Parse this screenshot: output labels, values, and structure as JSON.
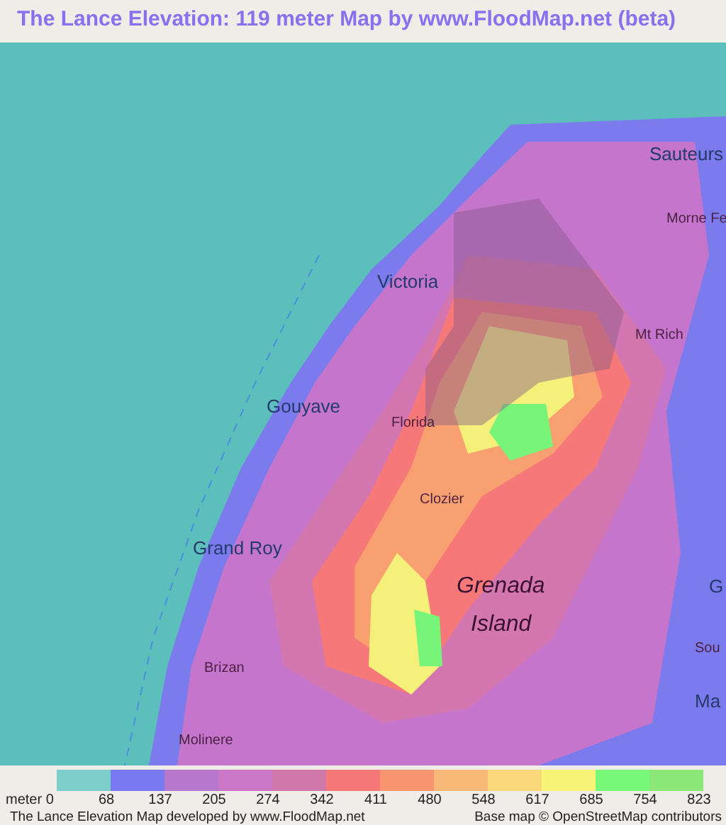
{
  "title": "The Lance Elevation: 119 meter Map by www.FloodMap.net (beta)",
  "map": {
    "places": [
      {
        "name": "Sauteurs",
        "kind": "town"
      },
      {
        "name": "Morne Fe",
        "kind": "small"
      },
      {
        "name": "Victoria",
        "kind": "town"
      },
      {
        "name": "Mt Rich",
        "kind": "small"
      },
      {
        "name": "Gouyave",
        "kind": "town"
      },
      {
        "name": "Florida",
        "kind": "small"
      },
      {
        "name": "Clozier",
        "kind": "small"
      },
      {
        "name": "Grand Roy",
        "kind": "town"
      },
      {
        "name": "Grenada",
        "kind": "island"
      },
      {
        "name": "Island",
        "kind": "island"
      },
      {
        "name": "Brizan",
        "kind": "small"
      },
      {
        "name": "G",
        "kind": "town"
      },
      {
        "name": "Sou",
        "kind": "small"
      },
      {
        "name": "Ma",
        "kind": "town"
      },
      {
        "name": "Molinere",
        "kind": "small"
      }
    ]
  },
  "legend": {
    "swatches": [
      {
        "color": "#7ecfcc"
      },
      {
        "color": "#7878f0"
      },
      {
        "color": "#b678cc"
      },
      {
        "color": "#cc78c8"
      },
      {
        "color": "#d078aa"
      },
      {
        "color": "#f77878"
      },
      {
        "color": "#f8946f"
      },
      {
        "color": "#f8b878"
      },
      {
        "color": "#f8d878"
      },
      {
        "color": "#f8f478"
      },
      {
        "color": "#78f878"
      },
      {
        "color": "#8ce878"
      }
    ],
    "labels": [
      "meter 0",
      "68",
      "137",
      "205",
      "274",
      "342",
      "411",
      "480",
      "548",
      "617",
      "685",
      "754",
      "823"
    ]
  },
  "footer": {
    "left": "The Lance Elevation Map developed by www.FloodMap.net",
    "right": "Base map © OpenStreetMap contributors"
  }
}
